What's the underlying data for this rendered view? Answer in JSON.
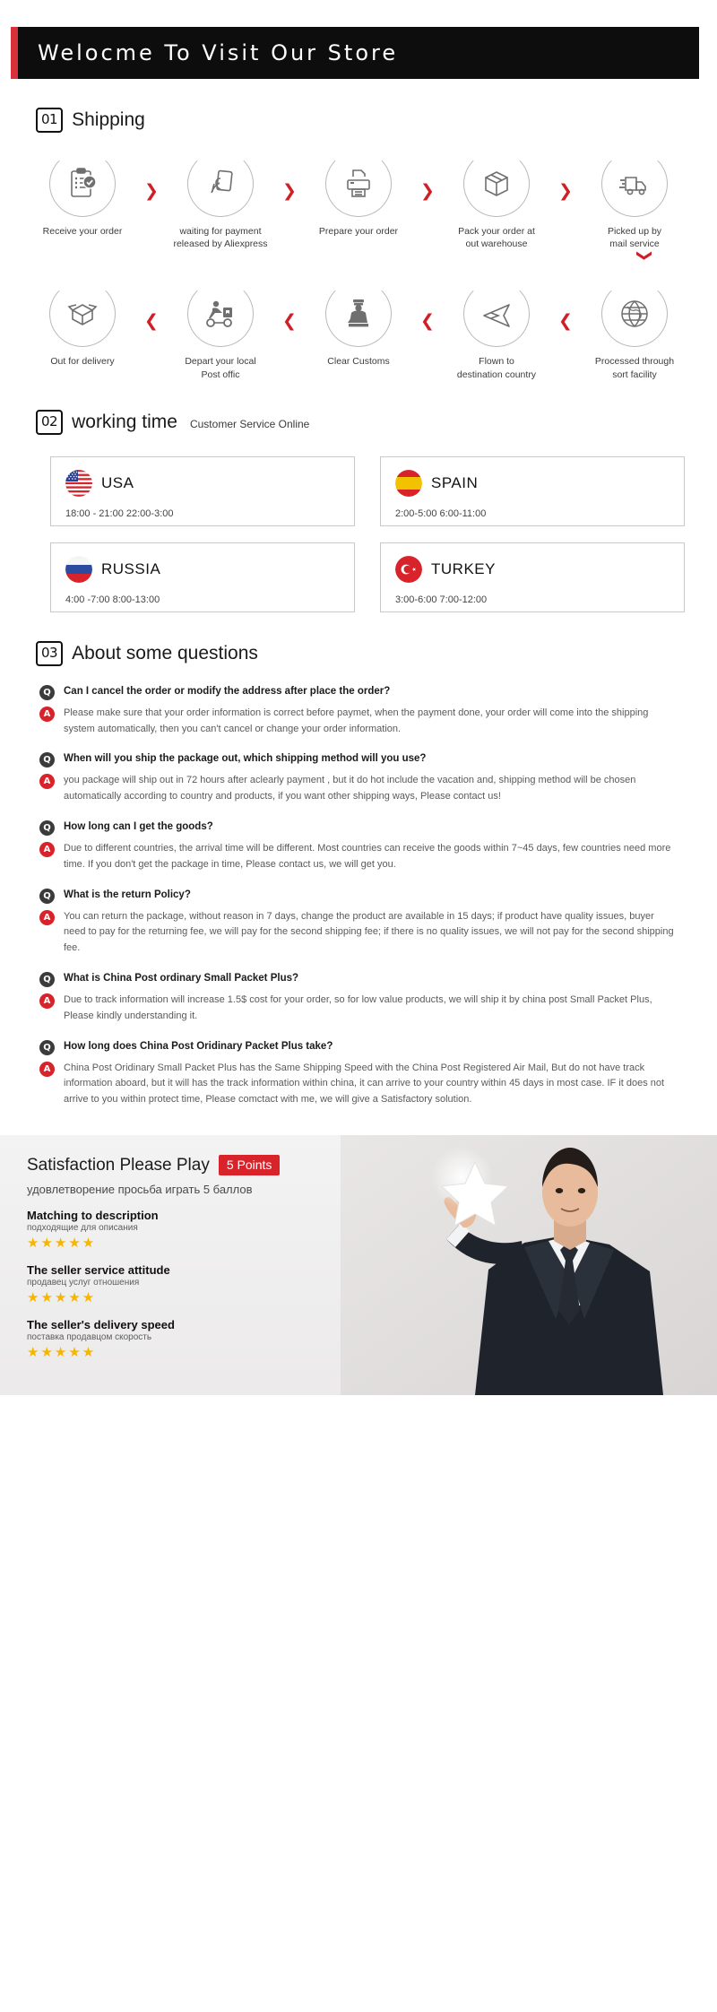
{
  "banner": {
    "title": "Welocme To Visit Our Store"
  },
  "sections": {
    "shipping": {
      "num": "01",
      "title": "Shipping"
    },
    "working": {
      "num": "02",
      "title": "working time",
      "subtitle": "Customer Service Online"
    },
    "questions": {
      "num": "03",
      "title": "About some questions"
    }
  },
  "shipping_row1": [
    {
      "icon": "clipboard-check-icon",
      "label": "Receive your order"
    },
    {
      "icon": "hand-card-icon",
      "label": "waiting for payment\nreleased by Aliexpress"
    },
    {
      "icon": "printer-icon",
      "label": "Prepare your order"
    },
    {
      "icon": "box-icon",
      "label": "Pack your order at\nout warehouse"
    },
    {
      "icon": "truck-icon",
      "label": "Picked up by\nmail service"
    }
  ],
  "shipping_row2": [
    {
      "icon": "open-box-icon",
      "label": "Out  for delivery"
    },
    {
      "icon": "scooter-icon",
      "label": "Depart your local\nPost offic"
    },
    {
      "icon": "customs-officer-icon",
      "label": "Clear Customs"
    },
    {
      "icon": "airplane-icon",
      "label": "Flown to\ndestination country"
    },
    {
      "icon": "globe-icon",
      "label": "Processed through\nsort facility"
    }
  ],
  "arrows": {
    "forward": "❯",
    "backward": "❮",
    "down": "❯"
  },
  "working_time": [
    {
      "country": "USA",
      "flag": "flag-usa",
      "hours": "18:00 - 21:00   22:00-3:00"
    },
    {
      "country": "SPAIN",
      "flag": "flag-spain",
      "hours": "2:00-5:00     6:00-11:00"
    },
    {
      "country": "RUSSIA",
      "flag": "flag-russia",
      "hours": "4:00 -7:00   8:00-13:00"
    },
    {
      "country": "TURKEY",
      "flag": "flag-turkey",
      "hours": "3:00-6:00    7:00-12:00"
    }
  ],
  "faq": [
    {
      "q": "Can I cancel the order or modify the address after place the order?",
      "a": "Please make sure that your order information is correct before paymet, when the payment done, your order will come into the shipping system automatically, then you can't cancel or change your order information."
    },
    {
      "q": "When will you ship the package out, which shipping method will you use?",
      "a": "you package will ship out in 72 hours after aclearly payment , but it do hot include the vacation and, shipping method will be chosen automatically according to country and products, if you want other shipping ways, Please contact us!"
    },
    {
      "q": "How long can I get the goods?",
      "a": "Due to different countries, the arrival time will be different. Most countries can receive the goods within 7~45 days, few countries need more time. If you don't get the package in time, Please contact us, we will get you."
    },
    {
      "q": "What is the return Policy?",
      "a": "You can return the package, without reason in 7 days, change the product are available in 15 days; if product have quality issues, buyer need to pay for the returning fee, we will pay for the second shipping fee; if there is no quality issues, we will not pay for the second shipping fee."
    },
    {
      "q": "What is China Post ordinary Small Packet Plus?",
      "a": "Due to track information will increase 1.5$ cost for your order, so for low value products, we will ship it by china post Small Packet Plus, Please kindly understanding it."
    },
    {
      "q": "How long does China Post Oridinary Packet Plus take?",
      "a": "China Post Oridinary Small Packet Plus has the Same Shipping Speed with the China Post Registered Air Mail, But do not have track information aboard, but it will has the track information within china, it can arrive to your country within 45 days in most case. IF it does not arrive to you within protect time, Please comctact with me, we will give a Satisfactory solution."
    }
  ],
  "footer": {
    "title": "Satisfaction Please Play",
    "points_badge": "5 Points",
    "subtitle_ru": "удовлетворение просьба играть 5 баллов",
    "criteria": [
      {
        "en": "Matching to description",
        "ru": "подходящие для описания",
        "stars": "★★★★★"
      },
      {
        "en": "The seller service attitude",
        "ru": "продавец услуг отношения",
        "stars": "★★★★★"
      },
      {
        "en": "The seller's delivery speed",
        "ru": "поставка продавцом скорость",
        "stars": "★★★★★"
      }
    ]
  },
  "colors": {
    "accent_red": "#d8232a",
    "banner_bg": "#0d0d0d",
    "star_gold": "#f7b500",
    "icon_gray": "#6f6f6f"
  }
}
